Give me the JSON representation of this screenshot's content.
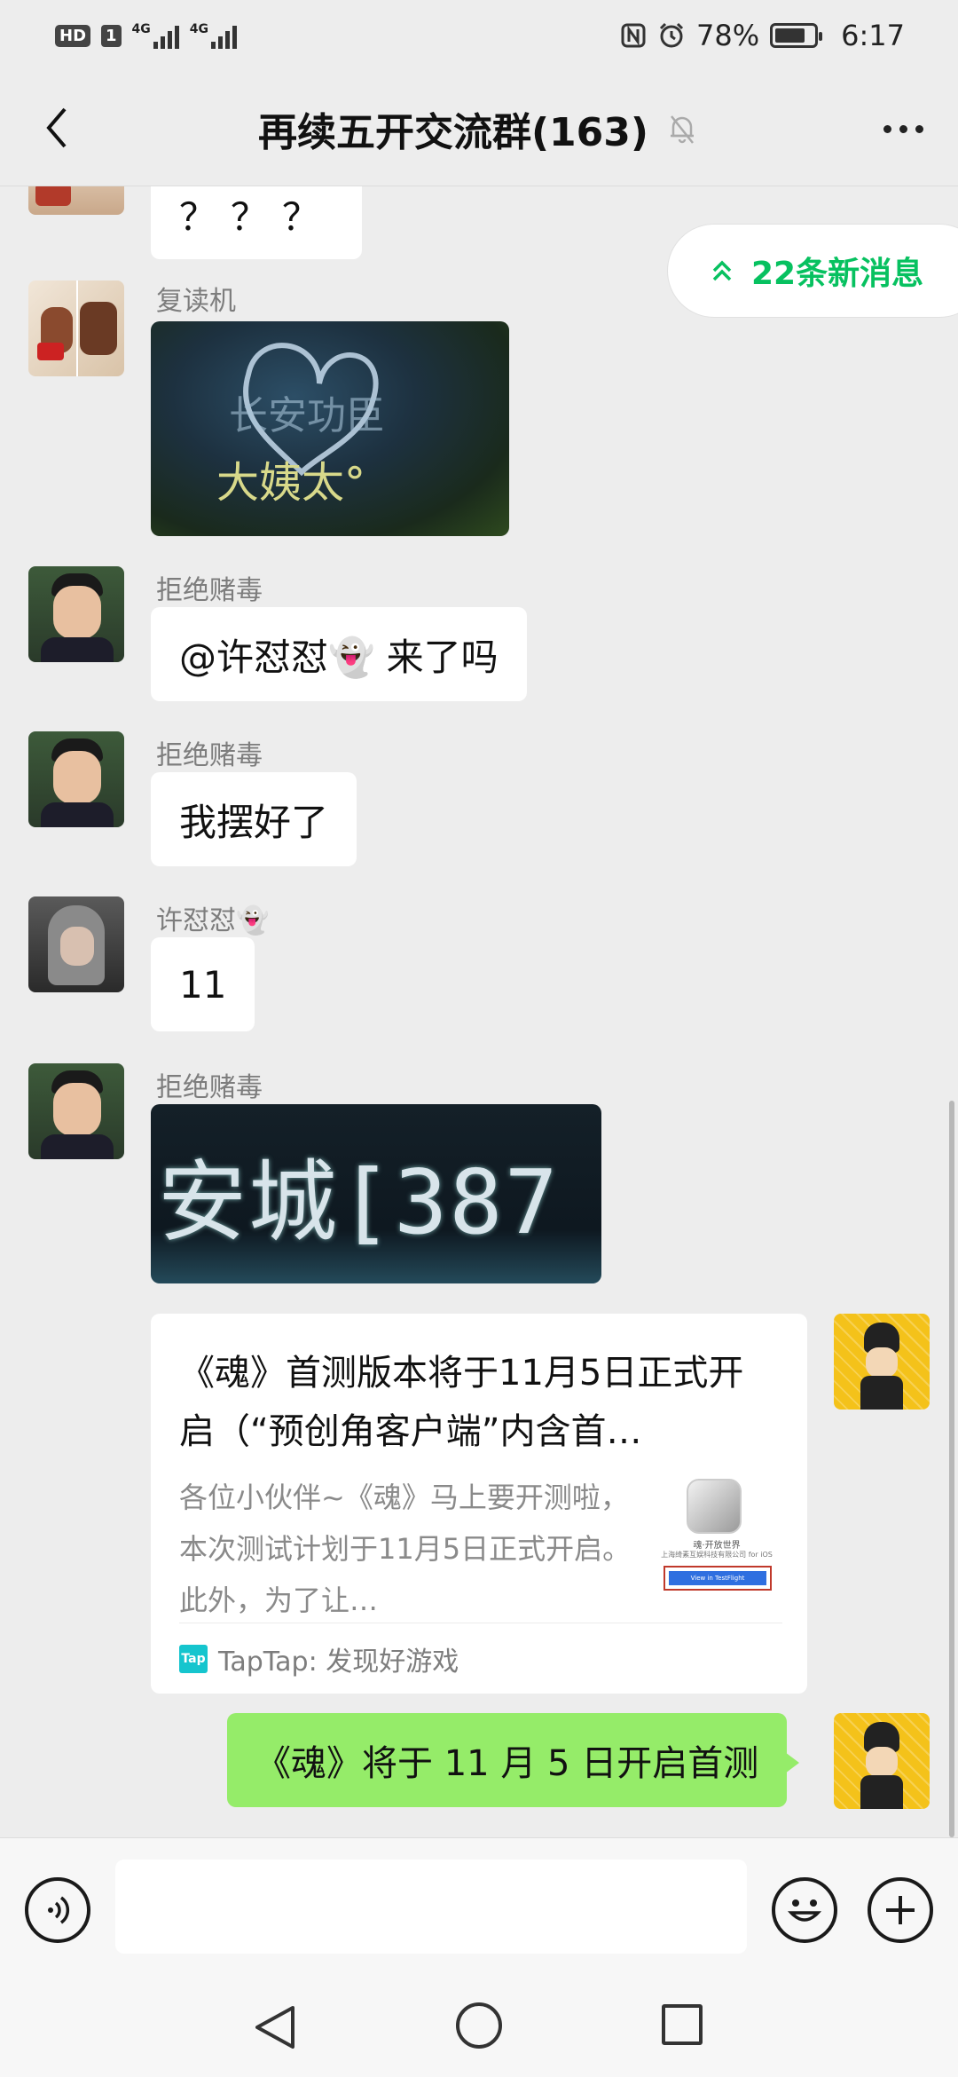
{
  "status_bar": {
    "hd": "HD",
    "sim": "1",
    "network1": "4G",
    "network2": "4G",
    "battery_text": "78%",
    "battery_level": 0.78,
    "time": "6:17"
  },
  "header": {
    "title": "再续五开交流群(163)"
  },
  "new_messages": {
    "label": "22条新消息"
  },
  "messages": {
    "m0": {
      "text": "？？？"
    },
    "m1": {
      "sender": "复读机",
      "image_text_top": "长安功臣",
      "image_text_bottom": "大姨太°"
    },
    "m2": {
      "sender": "拒绝赌毒",
      "text": "@许怼怼👻 来了吗"
    },
    "m3": {
      "sender": "拒绝赌毒",
      "text": "我摆好了"
    },
    "m4": {
      "sender": "许怼怼👻",
      "text": "11"
    },
    "m5": {
      "sender": "拒绝赌毒",
      "image_text": "安城[387"
    },
    "m6": {
      "title": "《魂》首测版本将于11月5日正式开启（“预创角客户端”内含首…",
      "desc": "各位小伙伴~《魂》马上要开测啦，本次测试计划于11月5日正式开启。此外，为了让…",
      "thumb_caption": "魂·开放世界",
      "thumb_company": "上海绮素互娱科技有限公司 for iOS",
      "thumb_button": "View in TestFlight",
      "source": "TapTap: 发现好游戏",
      "source_badge": "Tap"
    },
    "m7": {
      "text": "《魂》将于 11 月 5 日开启首测"
    }
  },
  "input": {
    "value": ""
  },
  "colors": {
    "accent_green": "#07c160",
    "bubble_green": "#95ec69",
    "background": "#ededed"
  }
}
